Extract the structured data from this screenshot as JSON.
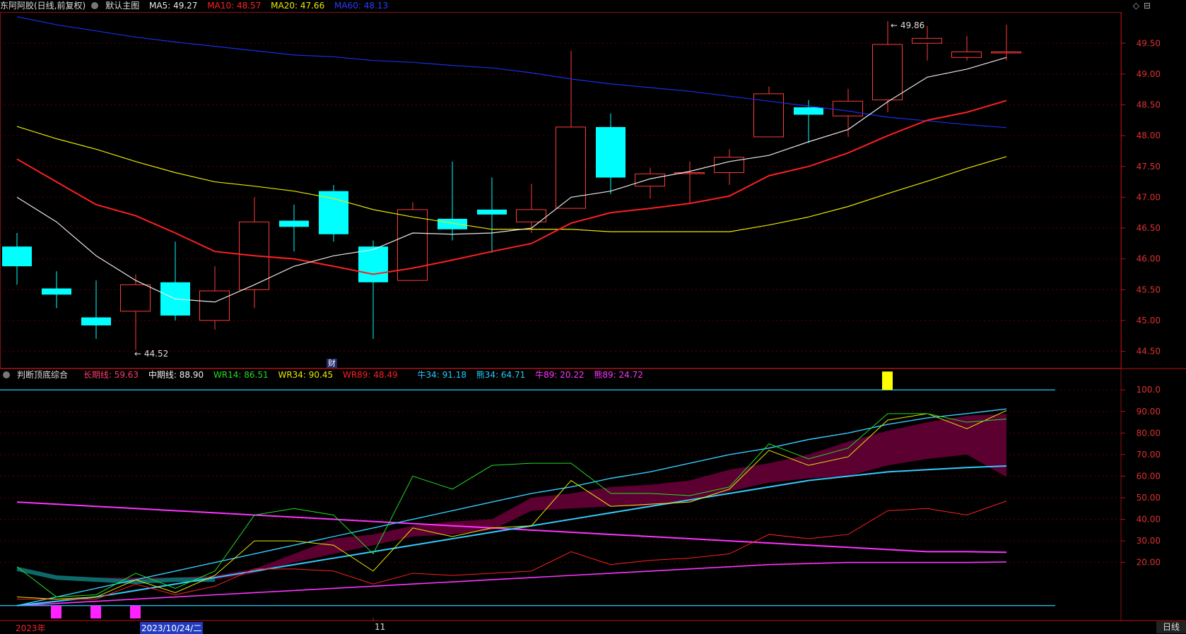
{
  "main_legend": {
    "stock": "东阿阿胶(日线,前复权)",
    "chart_name": "默认主图",
    "ma5": "MA5: 49.27",
    "ma10": "MA10: 48.57",
    "ma20": "MA20: 47.66",
    "ma60": "MA60: 48.13"
  },
  "sub_legend": {
    "indicator": "判断顶底综合",
    "long": "长期线: 59.63",
    "mid": "中期线: 88.90",
    "wr14": "WR14: 86.51",
    "wr34": "WR34: 90.45",
    "wr89": "WR89: 48.49",
    "niu34": "牛34: 91.18",
    "xiong34": "熊34: 64.71",
    "niu89": "牛89: 20.22",
    "xiong89": "熊89: 24.72"
  },
  "annotations": {
    "high": "49.86",
    "low": "44.52",
    "cai": "财"
  },
  "price_axis": [
    "49.50",
    "49.00",
    "48.50",
    "48.00",
    "47.50",
    "47.00",
    "46.50",
    "46.00",
    "45.50",
    "45.00",
    "44.50"
  ],
  "indicator_axis": [
    "100.0",
    "90.00",
    "80.00",
    "70.00",
    "60.00",
    "50.00",
    "40.00",
    "30.00",
    "20.00"
  ],
  "date_bar": {
    "year": "2023年",
    "selected": "2023/10/24/二",
    "month": "11",
    "period": "日线"
  },
  "colors": {
    "up": "#ff3b3b",
    "down": "#00ffff",
    "ma5": "#e8e8e8",
    "ma10": "#ff2020",
    "ma20": "#e8e800",
    "ma60": "#1a2ee8"
  },
  "chart_data": {
    "type": "candlestick",
    "candles": [
      {
        "o": 46.2,
        "h": 46.42,
        "l": 45.58,
        "c": 45.88
      },
      {
        "o": 45.52,
        "h": 45.8,
        "l": 45.2,
        "c": 45.42
      },
      {
        "o": 45.05,
        "h": 45.65,
        "l": 44.7,
        "c": 44.92
      },
      {
        "o": 45.15,
        "h": 45.75,
        "l": 44.52,
        "c": 45.58
      },
      {
        "o": 45.62,
        "h": 46.28,
        "l": 45.0,
        "c": 45.08
      },
      {
        "o": 45.0,
        "h": 45.88,
        "l": 44.85,
        "c": 45.48
      },
      {
        "o": 45.5,
        "h": 47.0,
        "l": 45.2,
        "c": 46.6
      },
      {
        "o": 46.62,
        "h": 46.88,
        "l": 46.12,
        "c": 46.52
      },
      {
        "o": 47.1,
        "h": 47.2,
        "l": 46.28,
        "c": 46.4
      },
      {
        "o": 46.2,
        "h": 46.3,
        "l": 44.7,
        "c": 45.62
      },
      {
        "o": 45.65,
        "h": 46.92,
        "l": 45.65,
        "c": 46.8
      },
      {
        "o": 46.65,
        "h": 47.58,
        "l": 46.3,
        "c": 46.48
      },
      {
        "o": 46.8,
        "h": 47.32,
        "l": 46.1,
        "c": 46.72
      },
      {
        "o": 46.6,
        "h": 47.22,
        "l": 46.42,
        "c": 46.8
      },
      {
        "o": 46.82,
        "h": 49.38,
        "l": 46.82,
        "c": 48.14
      },
      {
        "o": 48.14,
        "h": 48.36,
        "l": 47.05,
        "c": 47.32
      },
      {
        "o": 47.18,
        "h": 47.48,
        "l": 46.98,
        "c": 47.38
      },
      {
        "o": 47.4,
        "h": 47.58,
        "l": 46.9,
        "c": 47.4
      },
      {
        "o": 47.4,
        "h": 47.78,
        "l": 47.2,
        "c": 47.65
      },
      {
        "o": 47.98,
        "h": 48.8,
        "l": 47.98,
        "c": 48.68
      },
      {
        "o": 48.46,
        "h": 48.58,
        "l": 47.88,
        "c": 48.34
      },
      {
        "o": 48.32,
        "h": 48.76,
        "l": 47.98,
        "c": 48.56
      },
      {
        "o": 48.58,
        "h": 49.86,
        "l": 48.38,
        "c": 49.48
      },
      {
        "o": 49.5,
        "h": 49.78,
        "l": 49.22,
        "c": 49.58
      },
      {
        "o": 49.27,
        "h": 49.62,
        "l": 49.22,
        "c": 49.36
      },
      {
        "o": 49.36,
        "h": 49.8,
        "l": 49.22,
        "c": 49.36
      }
    ],
    "ma5": [
      47.0,
      46.6,
      46.05,
      45.65,
      45.35,
      45.3,
      45.58,
      45.88,
      46.05,
      46.15,
      46.42,
      46.4,
      46.42,
      46.5,
      47.0,
      47.1,
      47.3,
      47.42,
      47.58,
      47.68,
      47.9,
      48.1,
      48.55,
      48.95,
      49.08,
      49.27
    ],
    "ma10": [
      47.62,
      47.25,
      46.88,
      46.7,
      46.42,
      46.12,
      46.05,
      46.0,
      45.88,
      45.75,
      45.85,
      45.98,
      46.12,
      46.25,
      46.58,
      46.75,
      46.82,
      46.9,
      47.02,
      47.35,
      47.5,
      47.72,
      48.0,
      48.25,
      48.38,
      48.57
    ],
    "ma20": [
      48.15,
      47.95,
      47.78,
      47.58,
      47.4,
      47.25,
      47.18,
      47.1,
      46.98,
      46.8,
      46.68,
      46.58,
      46.48,
      46.48,
      46.48,
      46.44,
      46.44,
      46.44,
      46.44,
      46.55,
      46.68,
      46.85,
      47.06,
      47.26,
      47.47,
      47.66
    ],
    "ma60": [
      49.93,
      49.8,
      49.7,
      49.6,
      49.52,
      49.45,
      49.38,
      49.31,
      49.28,
      49.22,
      49.19,
      49.14,
      49.1,
      49.02,
      48.92,
      48.84,
      48.78,
      48.72,
      48.64,
      48.56,
      48.48,
      48.4,
      48.3,
      48.24,
      48.18,
      48.13
    ],
    "ylim": [
      44.3,
      49.95
    ],
    "indicator": {
      "ylim": [
        -4,
        104
      ],
      "wr14": [
        18,
        4,
        5,
        15,
        8,
        16,
        42,
        45,
        42,
        24,
        60,
        54,
        65,
        66,
        66,
        52,
        52,
        51,
        55,
        75,
        68,
        73,
        89,
        89,
        85,
        86.51
      ],
      "wr34": [
        4,
        3,
        4,
        12,
        6,
        14,
        30,
        30,
        28,
        16,
        36,
        32,
        36,
        37,
        58,
        46,
        47,
        48,
        54,
        72,
        65,
        69,
        86,
        89,
        82,
        90.45
      ],
      "wr89": [
        3,
        3,
        3,
        10,
        5,
        9,
        17,
        17,
        16,
        10,
        15,
        14,
        15,
        16,
        25,
        19,
        21,
        22,
        24,
        33,
        31,
        33,
        44,
        45,
        42,
        48.49
      ],
      "long": [
        17,
        13,
        12,
        11,
        12,
        12,
        15,
        20,
        24,
        28,
        32,
        33,
        35,
        44,
        45,
        46,
        46,
        48,
        53,
        57,
        59,
        60,
        65,
        68,
        70,
        59.63
      ],
      "mid": [
        18,
        14,
        13,
        13,
        13,
        14,
        17,
        24,
        31,
        33,
        37,
        39,
        40,
        50,
        52,
        55,
        56,
        58,
        63,
        66,
        70,
        76,
        81,
        85,
        88,
        88.9
      ],
      "niu34": [
        0,
        4,
        8,
        12,
        16,
        20,
        24,
        28,
        32,
        36,
        40,
        44,
        48,
        52,
        55,
        59,
        62,
        66,
        70,
        73,
        77,
        80,
        84,
        87,
        89,
        91.18
      ],
      "xiong34": [
        0,
        2,
        4,
        7,
        10,
        13,
        16,
        19,
        22,
        25,
        28,
        31,
        34,
        37,
        40,
        43,
        46,
        49,
        52,
        55,
        58,
        60,
        62,
        63,
        64,
        64.71
      ],
      "niu89": [
        0,
        1,
        2,
        3,
        4,
        5,
        6,
        7,
        8,
        9,
        10,
        11,
        12,
        13,
        14,
        15,
        16,
        17,
        18,
        19,
        19.5,
        20,
        20,
        20,
        20,
        20.22
      ],
      "xiong89": [
        48,
        47,
        46,
        45,
        44,
        43,
        42,
        41,
        40,
        39,
        38,
        37,
        36,
        35,
        34,
        33,
        32,
        31,
        30,
        29,
        28,
        27,
        26,
        25,
        25,
        24.72
      ]
    }
  }
}
